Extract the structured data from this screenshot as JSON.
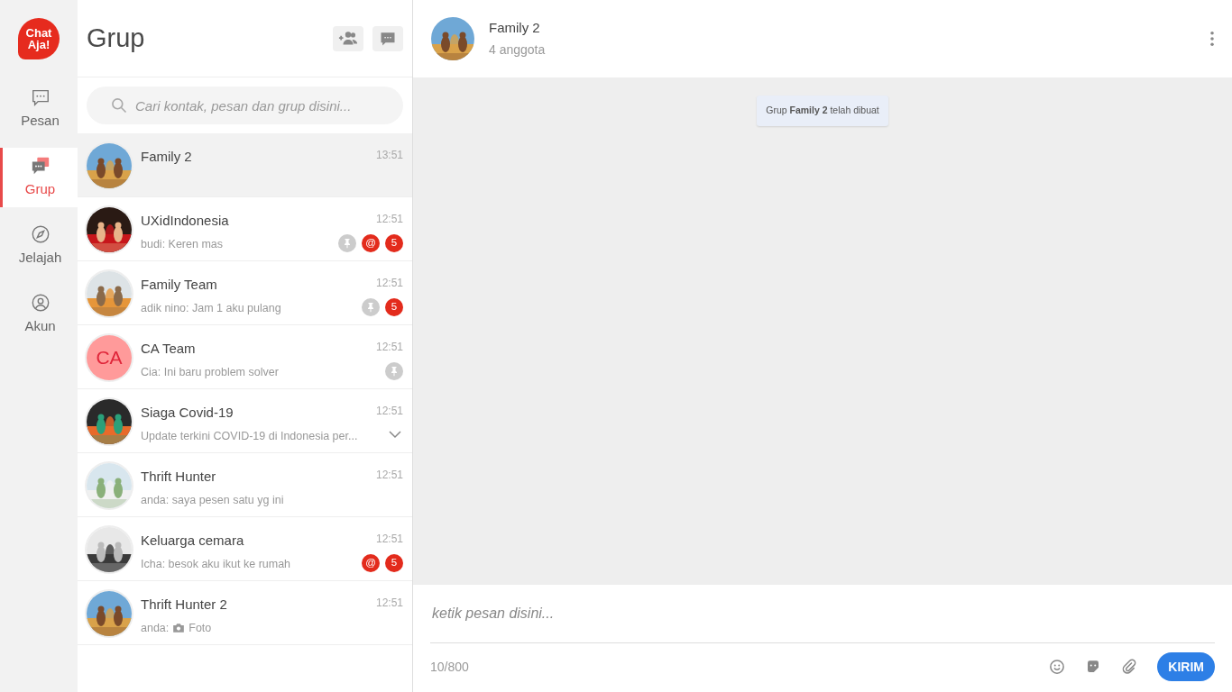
{
  "logo": [
    "Chat",
    "Aja!"
  ],
  "nav": [
    {
      "label": "Pesan",
      "kind": "chat",
      "selected": false
    },
    {
      "label": "Grup",
      "kind": "group",
      "selected": true
    },
    {
      "label": "Jelajah",
      "kind": "compass",
      "selected": false
    },
    {
      "label": "Akun",
      "kind": "user",
      "selected": false
    }
  ],
  "list_panel": {
    "title": "Grup",
    "search": {
      "placeholder": "Cari kontak, pesan dan grup disini..."
    }
  },
  "chats": [
    {
      "name": "Family 2",
      "time": "13:51",
      "selected": true,
      "pinned": false
    },
    {
      "name": "UXidIndonesia",
      "time": "12:51",
      "preview": "budi: Keren mas",
      "selected": false,
      "pinned": true,
      "mention": "@",
      "unread": "5"
    },
    {
      "name": "Family Team",
      "time": "12:51",
      "preview": "adik nino: Jam 1 aku pulang",
      "selected": false,
      "pinned": true,
      "unread": "5"
    },
    {
      "name": "CA Team",
      "time": "12:51",
      "preview": "Cia: Ini baru problem solver",
      "avatar": {
        "kind": "initials",
        "text": "CA"
      },
      "selected": false,
      "pinned": true
    },
    {
      "name": "Siaga Covid-19",
      "time": "12:51",
      "preview": "Update terkini COVID-19 di Indonesia per...",
      "selected": false,
      "pinned": false,
      "expandable": true
    },
    {
      "name": "Thrift Hunter",
      "time": "12:51",
      "preview": "anda: saya pesen satu yg ini",
      "selected": false,
      "pinned": false
    },
    {
      "name": "Keluarga cemara",
      "time": "12:51",
      "preview": "Icha: besok aku ikut ke rumah",
      "selected": false,
      "pinned": false,
      "mention": "@",
      "unread": "5"
    },
    {
      "name": "Thrift Hunter 2",
      "time": "12:51",
      "preview": "anda:",
      "attachment": {
        "label": "Foto"
      },
      "selected": false,
      "pinned": false
    }
  ],
  "conversation": {
    "title": "Family 2",
    "subtitle": "4 anggota",
    "system_message": "Grup **Family 2** telah dibuat",
    "composer": {
      "placeholder": "ketik pesan disini...",
      "counter": "10/800",
      "send": "KIRIM"
    }
  }
}
